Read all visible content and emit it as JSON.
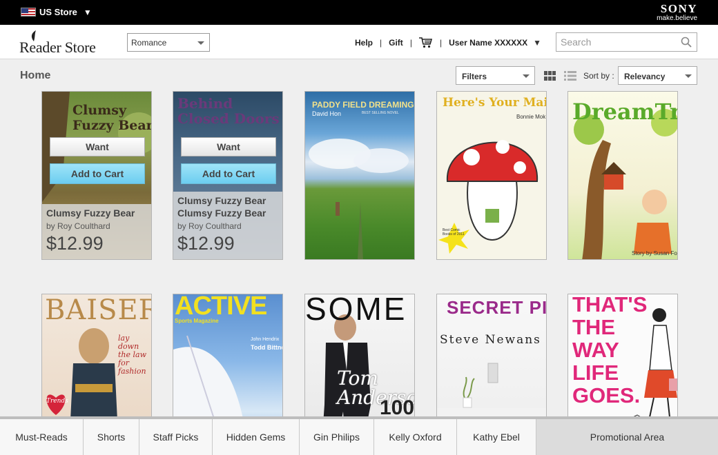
{
  "topbar": {
    "store_label": "US Store",
    "brand": "SONY",
    "tagline": "make.believe"
  },
  "header": {
    "logo_text": "Reader Store",
    "genre_selected": "Romance",
    "help": "Help",
    "gift": "Gift",
    "separator": "|",
    "user_name": "User Name XXXXXX",
    "search_placeholder": "Search"
  },
  "toolbar": {
    "page_title": "Home",
    "filters_label": "Filters",
    "sort_label": "Sort by :",
    "sort_selected": "Relevancy"
  },
  "books": [
    {
      "cover_title": "Clumsy Fuzzy Bear",
      "title": "Clumsy Fuzzy Bear",
      "author": "by Roy Coulthard",
      "price": "$12.99",
      "want": "Want",
      "add_to_cart": "Add to Cart"
    },
    {
      "cover_title": "Behind Closed Doors",
      "title": "Clumsy Fuzzy Bear Clumsy Fuzzy Bear",
      "author": "by Roy Coulthard",
      "price": "$12.99",
      "want": "Want",
      "add_to_cart": "Add to Cart"
    },
    {
      "cover_title": "PADDY FIELD DREAMING",
      "subtitle": "BEST SELLING NOVEL",
      "author": "David Hon"
    },
    {
      "cover_title": "Here's Your Mail",
      "author": "Bonnie Mok",
      "badge": "Best Comic Books of 2011"
    },
    {
      "cover_title": "DreamTree",
      "author": "Story by Susan Fox"
    },
    {
      "cover_title": "BAISER",
      "tagline": "lay down the law for fashion",
      "badge": "Trends"
    },
    {
      "cover_title": "ACTIVE",
      "subtitle": "Sports Magazine",
      "line1": "John Hendrix",
      "line2": "Todd Bittner"
    },
    {
      "cover_title": "SOME",
      "script": "Tom Anderson",
      "number": "100"
    },
    {
      "cover_title": "SECRET PICTURES",
      "author": "Steve Newans"
    },
    {
      "cover_title": "THAT'S THE WAY LIFE GOES."
    }
  ],
  "bottom_nav": {
    "tabs": [
      "Must-Reads",
      "Shorts",
      "Staff Picks",
      "Hidden Gems",
      "Gin Philips",
      "Kelly Oxford",
      "Kathy Ebel"
    ],
    "promo": "Promotional Area"
  },
  "colors": {
    "accent_cart": "#7fd6f3",
    "topbar": "#000000",
    "background": "#efefef"
  }
}
